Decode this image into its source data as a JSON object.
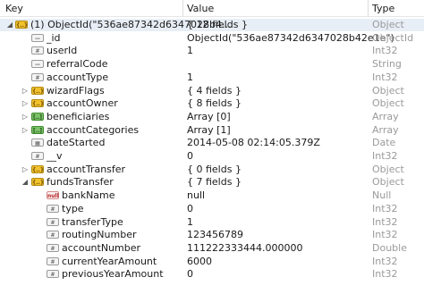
{
  "header": {
    "key": "Key",
    "value": "Value",
    "type": "Type"
  },
  "rows": [
    {
      "key": "(1) ObjectId(\"536ae87342d6347028b4...",
      "value": "{ 12 fields }",
      "type": "Object",
      "icon": "object",
      "expander": "open"
    },
    {
      "key": "_id",
      "value": "ObjectId(\"536ae87342d6347028b42e1e\")",
      "type": "ObjectId",
      "icon": "string",
      "expander": ""
    },
    {
      "key": "userId",
      "value": "1",
      "type": "Int32",
      "icon": "number",
      "expander": ""
    },
    {
      "key": "referralCode",
      "value": "",
      "type": "String",
      "icon": "string",
      "expander": ""
    },
    {
      "key": "accountType",
      "value": "1",
      "type": "Int32",
      "icon": "number",
      "expander": ""
    },
    {
      "key": "wizardFlags",
      "value": "{ 4 fields }",
      "type": "Object",
      "icon": "object",
      "expander": "closed"
    },
    {
      "key": "accountOwner",
      "value": "{ 8 fields }",
      "type": "Object",
      "icon": "object",
      "expander": "closed"
    },
    {
      "key": "beneficiaries",
      "value": "Array [0]",
      "type": "Array",
      "icon": "array",
      "expander": "closed"
    },
    {
      "key": "accountCategories",
      "value": "Array [1]",
      "type": "Array",
      "icon": "array",
      "expander": "closed"
    },
    {
      "key": "dateStarted",
      "value": "2014-05-08 02:14:05.379Z",
      "type": "Date",
      "icon": "date",
      "expander": ""
    },
    {
      "key": "__v",
      "value": "0",
      "type": "Int32",
      "icon": "number",
      "expander": ""
    },
    {
      "key": "accountTransfer",
      "value": "{ 0 fields }",
      "type": "Object",
      "icon": "object",
      "expander": "closed"
    },
    {
      "key": "fundsTransfer",
      "value": "{ 7 fields }",
      "type": "Object",
      "icon": "object",
      "expander": "open"
    },
    {
      "key": "bankName",
      "value": "null",
      "type": "Null",
      "icon": "null",
      "expander": ""
    },
    {
      "key": "type",
      "value": "0",
      "type": "Int32",
      "icon": "number",
      "expander": ""
    },
    {
      "key": "transferType",
      "value": "1",
      "type": "Int32",
      "icon": "number",
      "expander": ""
    },
    {
      "key": "routingNumber",
      "value": "123456789",
      "type": "Int32",
      "icon": "number",
      "expander": ""
    },
    {
      "key": "accountNumber",
      "value": "111222333444.000000",
      "type": "Double",
      "icon": "number",
      "expander": ""
    },
    {
      "key": "currentYearAmount",
      "value": "6000",
      "type": "Int32",
      "icon": "number",
      "expander": ""
    },
    {
      "key": "previousYearAmount",
      "value": "0",
      "type": "Int32",
      "icon": "number",
      "expander": ""
    }
  ],
  "icons": {
    "object": {
      "name": "object-icon",
      "glyph": "{..}"
    },
    "array": {
      "name": "array-icon",
      "glyph": "[..]"
    },
    "number": {
      "name": "number-icon",
      "glyph": "#"
    },
    "string": {
      "name": "string-icon",
      "glyph": "—"
    },
    "date": {
      "name": "calendar-icon",
      "glyph": "▦"
    },
    "null": {
      "name": "null-icon",
      "glyph": "null"
    }
  },
  "expanders": {
    "open": "◢",
    "closed": "▷"
  },
  "colors": {
    "selected_row": "#e8eef6",
    "type_text": "#9a9a9a",
    "object_icon": "#f2c22e",
    "array_icon": "#7cc36a"
  }
}
